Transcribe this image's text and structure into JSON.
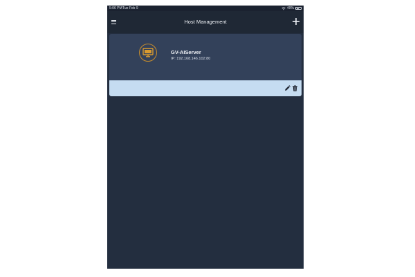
{
  "status_bar": {
    "time": "5:06 PM",
    "date": "Tue Feb 9",
    "battery": "49%",
    "battery_level": 0.49,
    "wifi_icon": "wifi-icon",
    "battery_icon": "battery-icon"
  },
  "nav": {
    "title": "Host Management",
    "menu_icon": "hamburger-menu-icon",
    "add_icon": "plus-icon"
  },
  "host": {
    "name": "GV-AIServer",
    "ip_label": "IP:",
    "ip": "192.168.146.102:80",
    "icon": "monitor-icon"
  },
  "actions": {
    "edit_icon": "pencil-icon",
    "delete_icon": "trash-icon"
  },
  "colors": {
    "background": "#232e3f",
    "nav_bar": "#1f2835",
    "card": "#33415a",
    "action_bar": "#c5dcf1",
    "accent": "#d89a30"
  }
}
